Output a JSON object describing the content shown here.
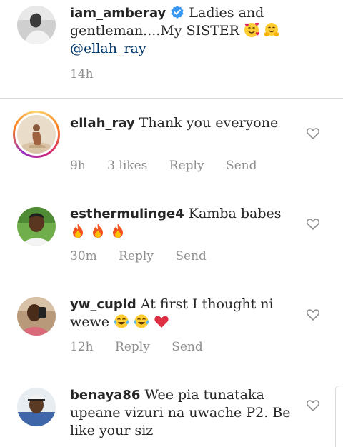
{
  "caption": {
    "username": "iam_amberay",
    "text": "Ladies and gentleman....My SISTER",
    "mention": "@ellah_ray",
    "time": "14h"
  },
  "comments": [
    {
      "username": "ellah_ray",
      "text": "Thank you everyone",
      "time": "9h",
      "likes": "3 likes",
      "reply": "Reply",
      "send": "Send"
    },
    {
      "username": "esthermulinge4",
      "text": "Kamba babes",
      "time": "30m",
      "reply": "Reply",
      "send": "Send"
    },
    {
      "username": "yw_cupid",
      "text": "At first I thought ni wewe",
      "time": "12h",
      "reply": "Reply",
      "send": "Send"
    },
    {
      "username": "benaya86",
      "text": "Wee pia tunataka upeane vizuri na uwache P2. Be like your siz"
    }
  ],
  "icons": {
    "verified": "verified-badge-icon",
    "like": "heart-outline-icon"
  },
  "colors": {
    "verified": "#3897f0",
    "mention": "#00376b",
    "meta": "#8e8e8e"
  }
}
